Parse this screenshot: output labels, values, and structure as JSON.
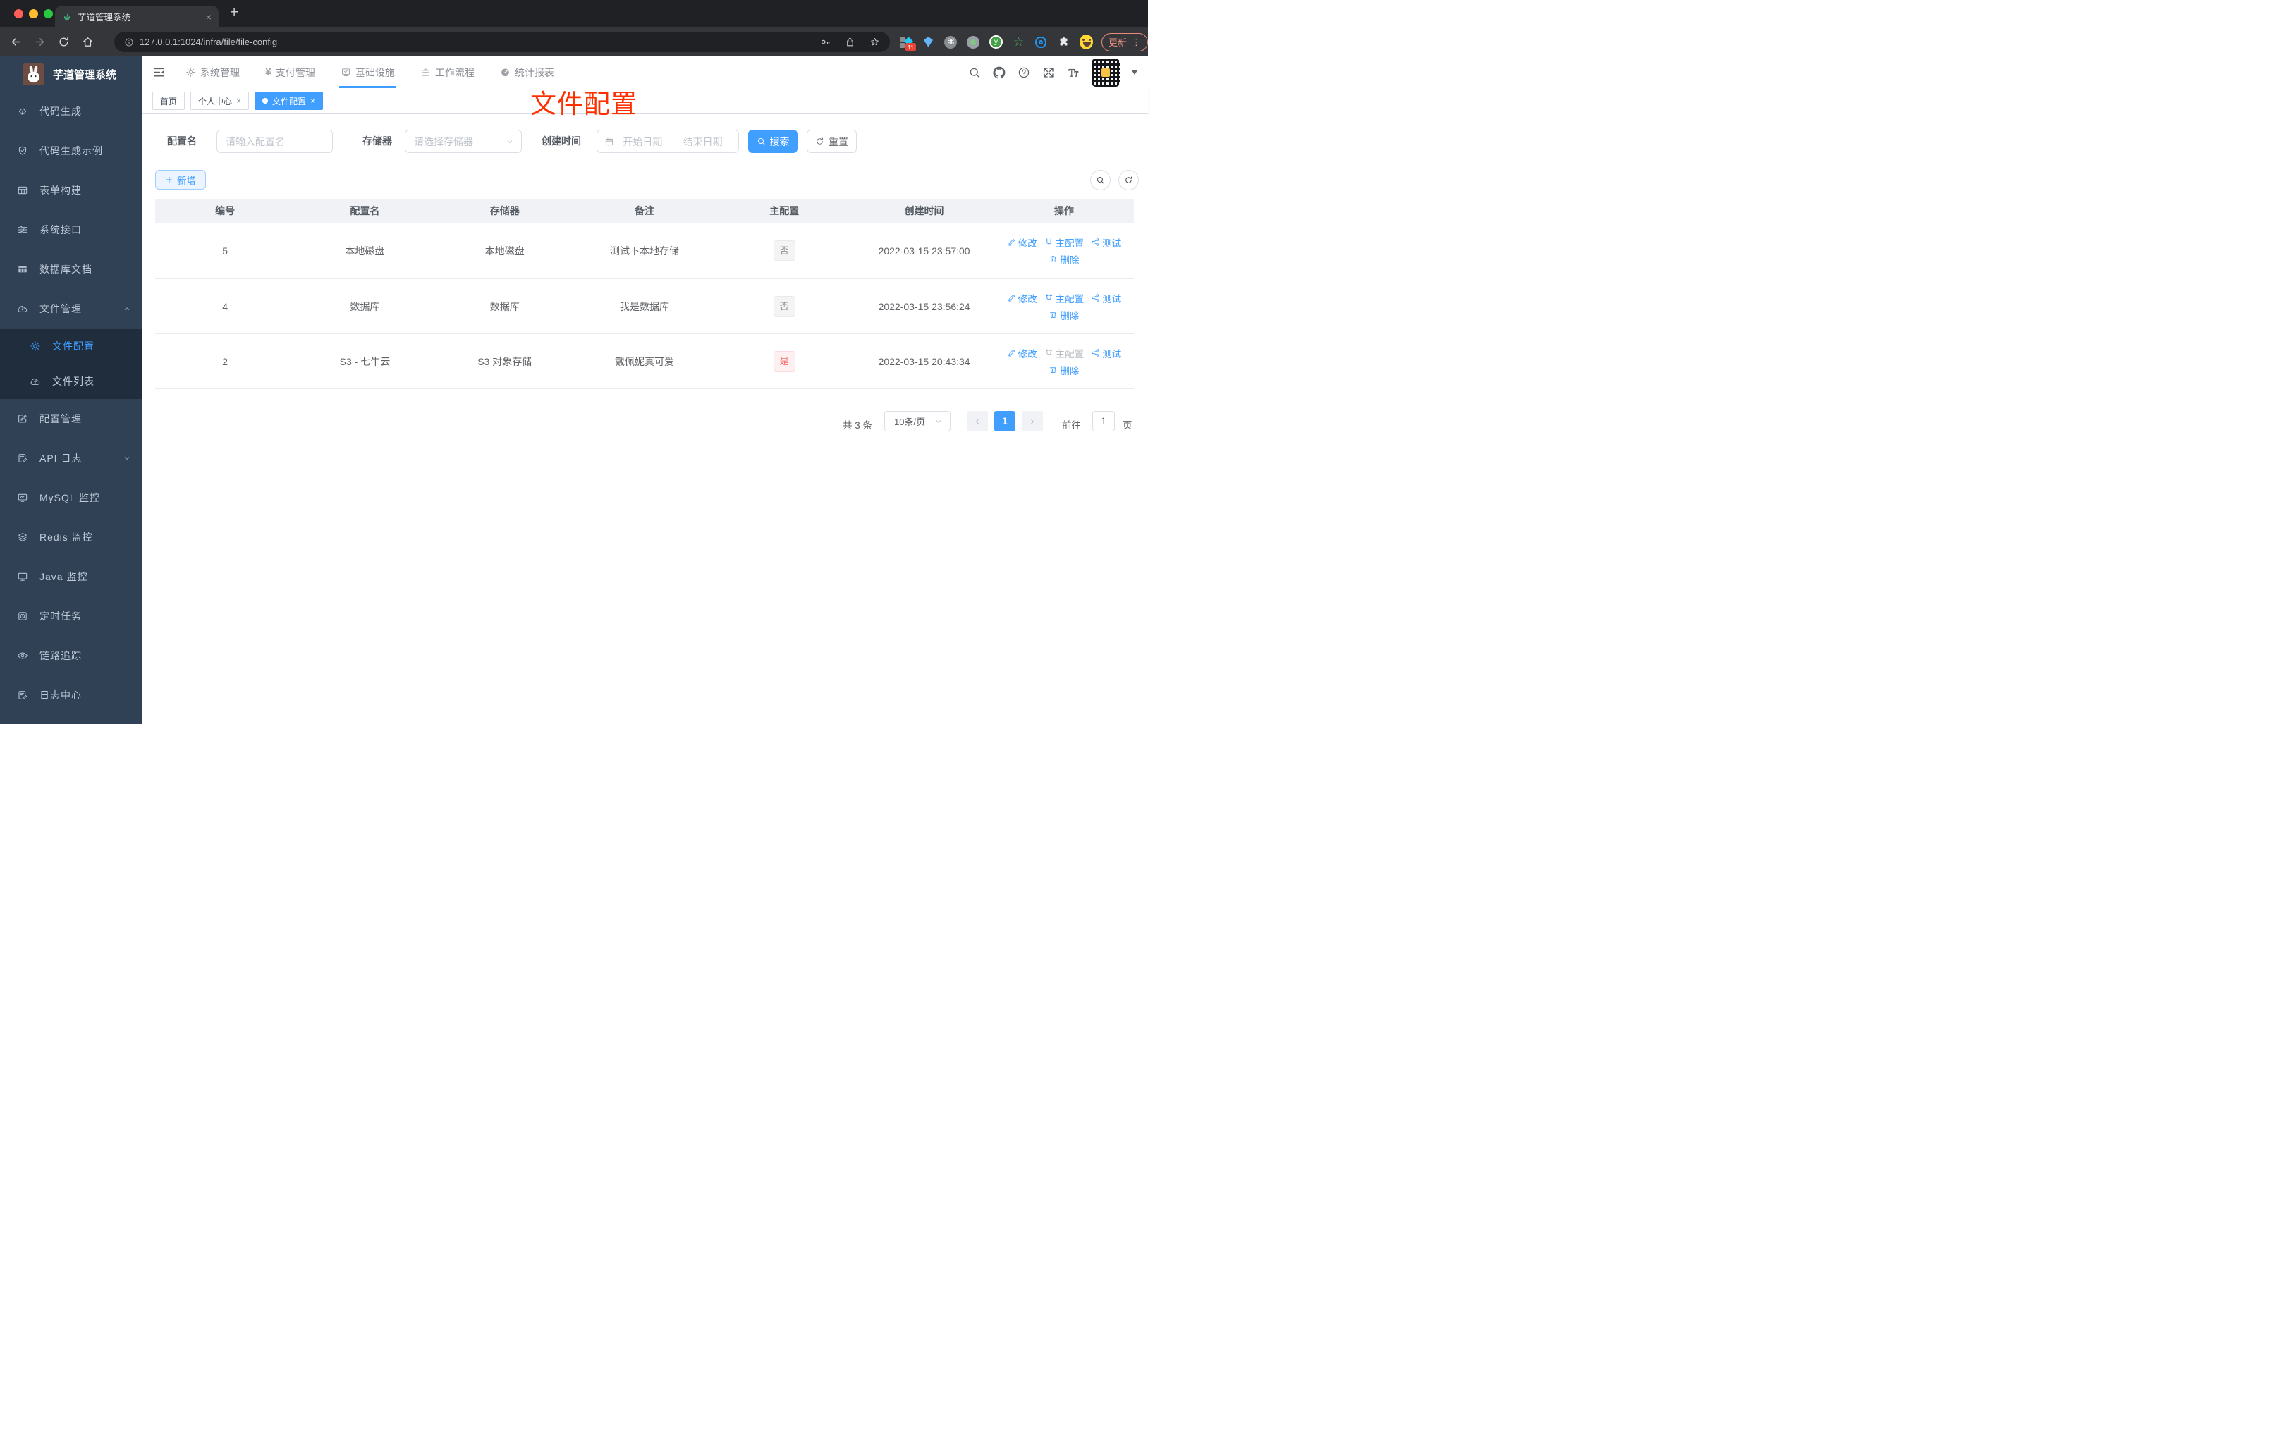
{
  "browser": {
    "tab_title": "芋道管理系统",
    "url": "127.0.0.1:1024/infra/file/file-config",
    "new_tab": "+",
    "extension_badge": "11",
    "update_label": "更新",
    "kebab": "⋮",
    "window_controls": [
      "close",
      "minimize",
      "zoom"
    ],
    "extension_icons": [
      "tampermonkey-icon",
      "gem-icon",
      "command-icon",
      "recorder-icon",
      "y-circle-icon",
      "green-star-icon",
      "blue-eye-icon",
      "puzzle-icon",
      "profile-emoji-icon"
    ]
  },
  "sidebar": {
    "brand": "芋道管理系统",
    "logo": "rabbit-avatar",
    "items": [
      {
        "label": "代码生成",
        "icon": "code-icon"
      },
      {
        "label": "代码生成示例",
        "icon": "shield-check-icon"
      },
      {
        "label": "表单构建",
        "icon": "form-grid-icon"
      },
      {
        "label": "系统接口",
        "icon": "sliders-icon"
      },
      {
        "label": "数据库文档",
        "icon": "table-icon"
      },
      {
        "label": "文件管理",
        "icon": "cloud-download-icon",
        "expanded": true
      },
      {
        "label": "文件配置",
        "icon": "gear-icon",
        "active": true,
        "submenu_of": "文件管理"
      },
      {
        "label": "文件列表",
        "icon": "cloud-upload-icon",
        "submenu_of": "文件管理"
      },
      {
        "label": "配置管理",
        "icon": "edit-square-icon"
      },
      {
        "label": "API 日志",
        "icon": "document-edit-icon",
        "collapsible": true
      },
      {
        "label": "MySQL 监控",
        "icon": "monitor-chart-icon"
      },
      {
        "label": "Redis 监控",
        "icon": "layers-icon"
      },
      {
        "label": "Java 监控",
        "icon": "monitor-icon"
      },
      {
        "label": "定时任务",
        "icon": "timer-icon"
      },
      {
        "label": "链路追踪",
        "icon": "eye-icon"
      },
      {
        "label": "日志中心",
        "icon": "document-edit-icon"
      }
    ]
  },
  "topnav": {
    "menu": [
      {
        "label": "系统管理",
        "icon": "gear-icon"
      },
      {
        "label": "支付管理",
        "icon": "yen-icon"
      },
      {
        "label": "基础设施",
        "icon": "monitor-check-icon",
        "active": true
      },
      {
        "label": "工作流程",
        "icon": "briefcase-icon"
      },
      {
        "label": "统计报表",
        "icon": "gauge-icon"
      }
    ],
    "yen_glyph": "¥",
    "right_icons": [
      "search-icon",
      "github-icon",
      "help-icon",
      "fullscreen-icon",
      "font-size-icon",
      "avatar-qr",
      "caret-down-icon"
    ],
    "font_size_glyph": "Tt"
  },
  "tabs_bar": [
    {
      "label": "首页",
      "closable": false,
      "active": false
    },
    {
      "label": "个人中心",
      "closable": true,
      "active": false
    },
    {
      "label": "文件配置",
      "closable": true,
      "active": true
    }
  ],
  "watermark": "文件配置",
  "filters": {
    "name_label": "配置名",
    "name_placeholder": "请输入配置名",
    "storage_label": "存储器",
    "storage_placeholder": "请选择存储器",
    "date_label": "创建时间",
    "date_start_placeholder": "开始日期",
    "date_separator": "-",
    "date_end_placeholder": "结束日期",
    "search_label": "搜索",
    "reset_label": "重置"
  },
  "toolbar": {
    "add_label": "新增"
  },
  "table": {
    "headers": [
      "编号",
      "配置名",
      "存储器",
      "备注",
      "主配置",
      "创建时间",
      "操作"
    ],
    "actions": {
      "edit": "修改",
      "master": "主配置",
      "test": "测试",
      "del": "删除"
    },
    "rows": [
      {
        "id": "5",
        "name": "本地磁盘",
        "storage": "本地磁盘",
        "remark": "测试下本地存储",
        "master": "否",
        "master_type": "info",
        "created": "2022-03-15 23:57:00",
        "master_action_disabled": false
      },
      {
        "id": "4",
        "name": "数据库",
        "storage": "数据库",
        "remark": "我是数据库",
        "master": "否",
        "master_type": "info",
        "created": "2022-03-15 23:56:24",
        "master_action_disabled": false
      },
      {
        "id": "2",
        "name": "S3 - 七牛云",
        "storage": "S3 对象存储",
        "remark": "戴佩妮真可爱",
        "master": "是",
        "master_type": "danger",
        "created": "2022-03-15 20:43:34",
        "master_action_disabled": true
      }
    ]
  },
  "pagination": {
    "total": "共 3 条",
    "page_size": "10条/页",
    "prev": "‹",
    "next": "›",
    "current_page": "1",
    "goto_label": "前往",
    "goto_value": "1",
    "page_unit": "页"
  },
  "colors": {
    "accent": "#409eff",
    "danger": "#f56c6c",
    "watermark": "#ff3000",
    "sidebar_bg": "#304156",
    "submenu_bg": "#1f2d3d"
  }
}
